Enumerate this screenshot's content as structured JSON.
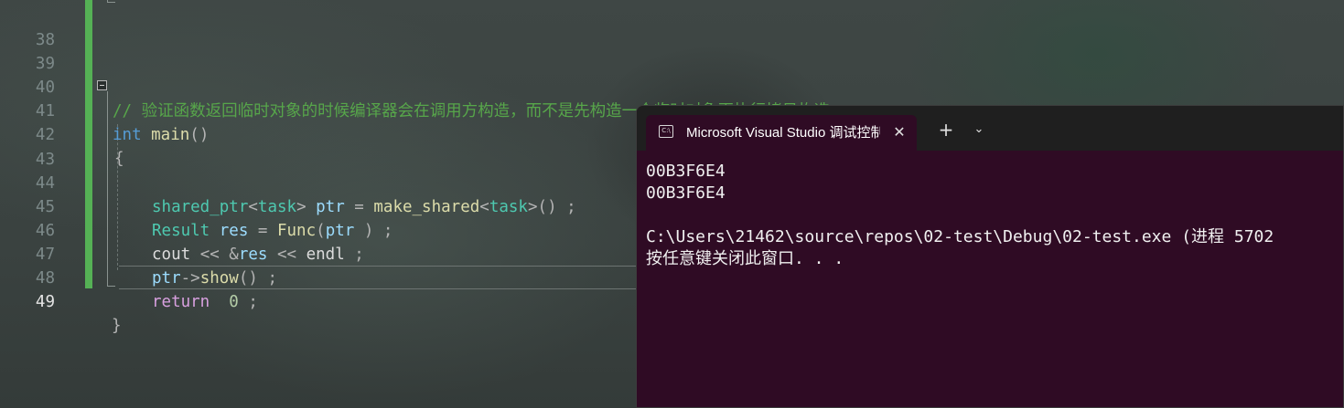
{
  "editor": {
    "lines": [
      {
        "num": "38"
      },
      {
        "num": "39"
      },
      {
        "num": "40",
        "comment": "// 验证函数返回临时对象的时候编译器会在调用方构造，而不是先构造一个临时对象再执行拷贝构造"
      },
      {
        "num": "41",
        "t1": "int",
        "t2": " main",
        "t3": "()"
      },
      {
        "num": "42",
        "t1": "{"
      },
      {
        "num": "43"
      },
      {
        "num": "44",
        "t1": "shared_ptr",
        "t2": "<",
        "t3": "task",
        "t4": ">",
        "t5": " ptr",
        "t6": " = ",
        "t7": "make_shared",
        "t8": "<",
        "t9": "task",
        "t10": ">",
        "t11": "() ;"
      },
      {
        "num": "45",
        "t1": "Result",
        "t2": " res",
        "t3": " = ",
        "t4": "Func",
        "t5": "(",
        "t6": "ptr",
        "t7": " ) ;"
      },
      {
        "num": "46",
        "t1": "cout",
        "t2": " << &",
        "t3": "res",
        "t4": " << ",
        "t5": "endl",
        "t6": " ;"
      },
      {
        "num": "47",
        "t1": "ptr",
        "t2": "->",
        "t3": "show",
        "t4": "() ;"
      },
      {
        "num": "48",
        "t1": "return",
        "t2": "  0",
        "t3": " ;"
      },
      {
        "num": "49",
        "t1": "}"
      }
    ]
  },
  "terminal": {
    "tab_title": "Microsoft Visual Studio 调试控制台",
    "tab_icon_text": "C:\\",
    "close_glyph": "✕",
    "new_tab_glyph": "+",
    "dropdown_glyph": "⌄",
    "output": [
      "00B3F6E4",
      "00B3F6E4",
      "",
      "C:\\Users\\21462\\source\\repos\\02-test\\Debug\\02-test.exe (进程 5702",
      "按任意键关闭此窗口. . ."
    ]
  },
  "colors": {
    "terminal_bg": "#2f0b24",
    "gutter_green": "#55b155",
    "comment": "#57a64a",
    "keyword": "#569cd6",
    "type": "#4ec9b0"
  }
}
